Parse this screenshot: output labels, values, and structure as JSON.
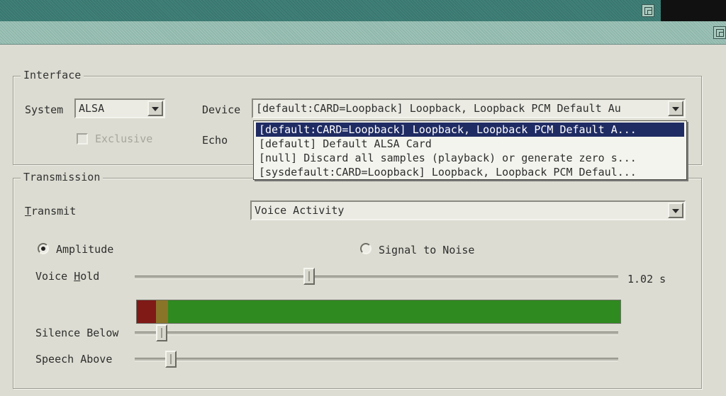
{
  "colors": {
    "selection": "#1f2b63",
    "meter_red": "#7f1a17",
    "meter_yellow": "#8a7428",
    "meter_green": "#2f8a1f"
  },
  "interface": {
    "group_title": "Interface",
    "system_label": "System",
    "system_value": "ALSA",
    "exclusive_label": "Exclusive",
    "exclusive_checked": false,
    "device_label": "Device",
    "device_value": "[default:CARD=Loopback] Loopback, Loopback PCM Default Au",
    "echo_label": "Echo",
    "device_options": [
      "[default:CARD=Loopback] Loopback, Loopback PCM Default A...",
      "[default] Default ALSA Card",
      "[null] Discard all samples (playback) or generate zero s...",
      "[sysdefault:CARD=Loopback] Loopback, Loopback PCM Defaul..."
    ],
    "selected_option_index": 0
  },
  "transmission": {
    "group_title": "Transmission",
    "transmit_label_first": "T",
    "transmit_label_rest": "ransmit",
    "transmit_value": "Voice Activity",
    "amplitude_label": "Amplitude",
    "amplitude_selected": true,
    "snr_label": "Signal to Noise",
    "snr_selected": false,
    "voice_hold_label_a": "Voice ",
    "voice_hold_label_u": "H",
    "voice_hold_label_b": "old",
    "voice_hold_value": "1.02 s",
    "voice_hold_fraction": 0.36,
    "meter_red_fraction": 0.04,
    "meter_yellow_fraction": 0.025,
    "silence_below_label": "Silence Below",
    "silence_below_fraction": 0.055,
    "speech_above_label": "Speech Above",
    "speech_above_fraction": 0.075
  }
}
